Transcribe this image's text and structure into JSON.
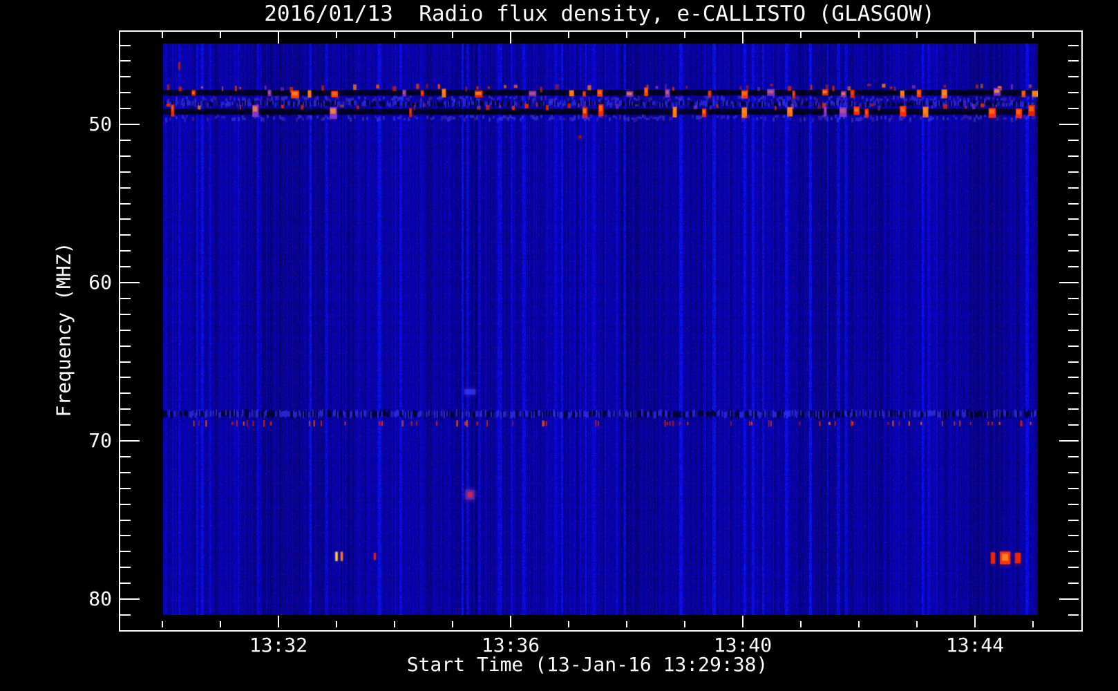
{
  "title": "2016/01/13  Radio flux density, e-CALLISTO (GLASGOW)",
  "colors": {
    "background": "#000000",
    "text": "#ffffff",
    "plot_base_blue": "#0000c8",
    "rfi_red": "#e02800",
    "rfi_orange": "#ff7518",
    "rfi_purple": "#7a33bb",
    "burst_yellow": "#ffd040"
  },
  "chart_data": {
    "type": "heatmap",
    "subtype": "radio-spectrogram",
    "title": "2016/01/13  Radio flux density, e-CALLISTO (GLASGOW)",
    "xlabel": "Start Time (13-Jan-16 13:29:38)",
    "ylabel": "Frequency (MHZ)",
    "grid": false,
    "legend": "none",
    "ylim_mhz": [
      44,
      82
    ],
    "y_axis": {
      "major_ticks": [
        50,
        60,
        70,
        80
      ],
      "major_labels": [
        "50",
        "60",
        "70",
        "80"
      ],
      "minor_start": 45,
      "minor_end": 81,
      "minor_step_mhz": 1
    },
    "x_axis": {
      "start_time": "13:29:38",
      "major_ticks": [
        {
          "minute": 32,
          "label": "13:32"
        },
        {
          "minute": 36,
          "label": "13:36"
        },
        {
          "minute": 40,
          "label": "13:40"
        },
        {
          "minute": 44,
          "label": "13:44"
        }
      ],
      "minor_start_minute": 30,
      "minor_end_minute": 45,
      "minor_step_minutes": 1
    },
    "background_noise": {
      "base_color": "#0000c8",
      "style": "vertical-streak blue noise"
    },
    "bands": [
      {
        "id": "rfi-48.0",
        "type": "burst-row",
        "freq": 48.0,
        "density": 0.5,
        "dash_h": [
          8,
          13
        ],
        "dark": "#000019",
        "dash_colors": [
          "#e02800",
          "#ff7518",
          "#ff4400",
          "#7a33bb"
        ]
      },
      {
        "id": "texture-48.7",
        "type": "tick-texture",
        "freq": 48.7,
        "h": 7
      },
      {
        "id": "rfi-49.2",
        "type": "burst-row",
        "freq": 49.2,
        "density": 0.55,
        "dash_h": [
          12,
          18
        ],
        "dark": "#00001c",
        "dash_colors": [
          "#ff2a00",
          "#ff7518",
          "#e02000",
          "#8833cc"
        ]
      },
      {
        "id": "texture-68.3",
        "type": "tick-texture",
        "freq": 68.3,
        "h": 9
      },
      {
        "id": "dash-68.9",
        "type": "sparse-red-dashes",
        "freq": 68.9,
        "count": 64,
        "colors": [
          "#d42000",
          "#ff5510",
          "#ff2200"
        ]
      }
    ],
    "features": [
      {
        "t": 30.29,
        "f": 46.3,
        "w": 2,
        "h": 11,
        "color": "#bb2010",
        "type": "dash"
      },
      {
        "t": 37.2,
        "f": 50.8,
        "w": 5,
        "h": 5,
        "color": "#8f1025",
        "type": "dot"
      },
      {
        "t": 35.3,
        "f": 66.9,
        "w": 16,
        "h": 8,
        "color": "#4040ff",
        "type": "soft"
      },
      {
        "t": 35.3,
        "f": 73.4,
        "w": 9,
        "h": 12,
        "color": "#cc2255",
        "halo": "#6e2fa8",
        "type": "halo-dot"
      },
      {
        "t": 33.0,
        "f": 77.3,
        "w": 3,
        "h": 13,
        "color": "#ffd040",
        "type": "dash"
      },
      {
        "t": 33.09,
        "f": 77.3,
        "w": 3,
        "h": 13,
        "color": "#ff7020",
        "type": "dash"
      },
      {
        "t": 33.66,
        "f": 77.3,
        "w": 3,
        "h": 10,
        "color": "#dd2018",
        "type": "dash"
      },
      {
        "t": 44.31,
        "f": 77.4,
        "w": 6,
        "h": 16,
        "color": "#ee2500",
        "type": "dash",
        "fringe": true
      },
      {
        "t": 44.52,
        "f": 77.4,
        "w": 15,
        "h": 18,
        "color": "#ff3300",
        "core": "#ff8020",
        "type": "blob",
        "fringe": true
      },
      {
        "t": 44.74,
        "f": 77.4,
        "w": 8,
        "h": 15,
        "color": "#ee2500",
        "type": "dash",
        "fringe": true
      }
    ]
  }
}
